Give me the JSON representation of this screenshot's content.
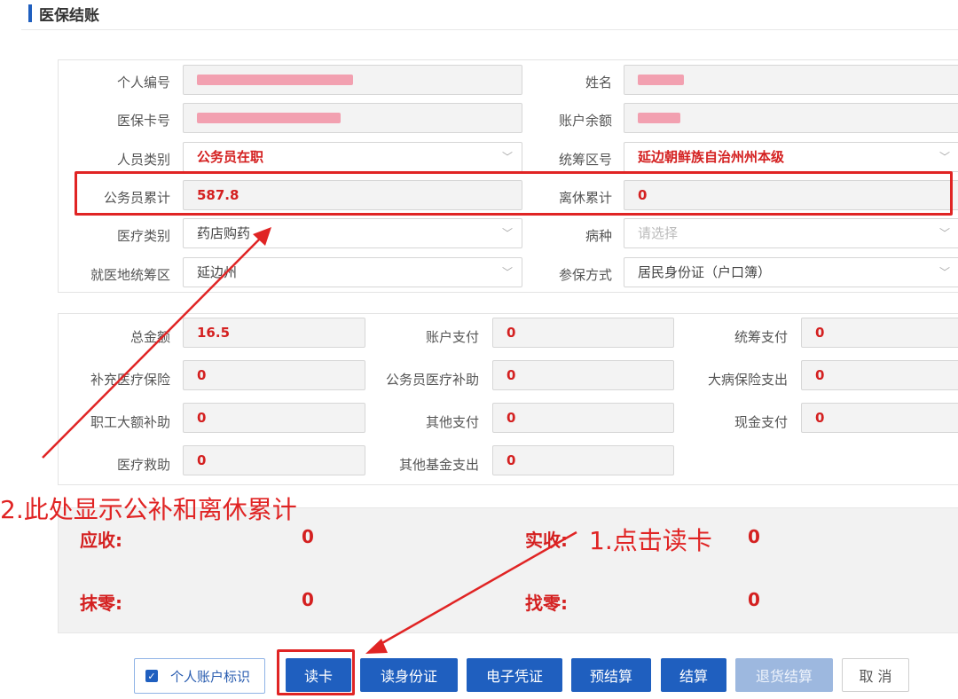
{
  "header": {
    "title": "医保结账"
  },
  "personal": {
    "id_label": "个人编号",
    "name_label": "姓名",
    "card_label": "医保卡号",
    "balance_label": "账户余额",
    "category_label": "人员类别",
    "category_value": "公务员在职",
    "region_label": "统筹区号",
    "region_value": "延边朝鲜族自治州州本级",
    "civil_total_label": "公务员累计",
    "civil_total_value": "587.8",
    "retired_total_label": "离休累计",
    "retired_total_value": "0",
    "medtype_label": "医疗类别",
    "medtype_value": "药店购药",
    "disease_label": "病种",
    "disease_placeholder": "请选择",
    "visit_region_label": "就医地统筹区",
    "visit_region_value": "延边州",
    "insured_label": "参保方式",
    "insured_value": "居民身份证（户口簿）"
  },
  "payments": {
    "total_label": "总金额",
    "total_value": "16.5",
    "account_label": "账户支付",
    "account_value": "0",
    "pool_label": "统筹支付",
    "pool_value": "0",
    "supp_label": "补充医疗保险",
    "supp_value": "0",
    "civil_aid_label": "公务员医疗补助",
    "civil_aid_value": "0",
    "critical_label": "大病保险支出",
    "critical_value": "0",
    "large_aid_label": "职工大额补助",
    "large_aid_value": "0",
    "other_pay_label": "其他支付",
    "other_pay_value": "0",
    "cash_label": "现金支付",
    "cash_value": "0",
    "relief_label": "医疗救助",
    "relief_value": "0",
    "other_fund_label": "其他基金支出",
    "other_fund_value": "0"
  },
  "summary": {
    "receivable_label": "应收:",
    "receivable_value": "0",
    "received_label": "实收:",
    "received_value": "0",
    "rounding_label": "抹零:",
    "rounding_value": "0",
    "change_label": "找零:",
    "change_value": "0"
  },
  "actions": {
    "personal_account_label": "个人账户标识",
    "read_card": "读卡",
    "read_id": "读身份证",
    "e_voucher": "电子凭证",
    "pre_settle": "预结算",
    "settle": "结算",
    "refund_settle": "退货结算",
    "cancel": "取 消"
  },
  "annotations": {
    "note1": "1.点击读卡",
    "note2": "2.此处显示公补和离休累计"
  },
  "colors": {
    "primary": "#1f5fbf",
    "value_red": "#d42020",
    "annotation_red": "#e02424"
  }
}
